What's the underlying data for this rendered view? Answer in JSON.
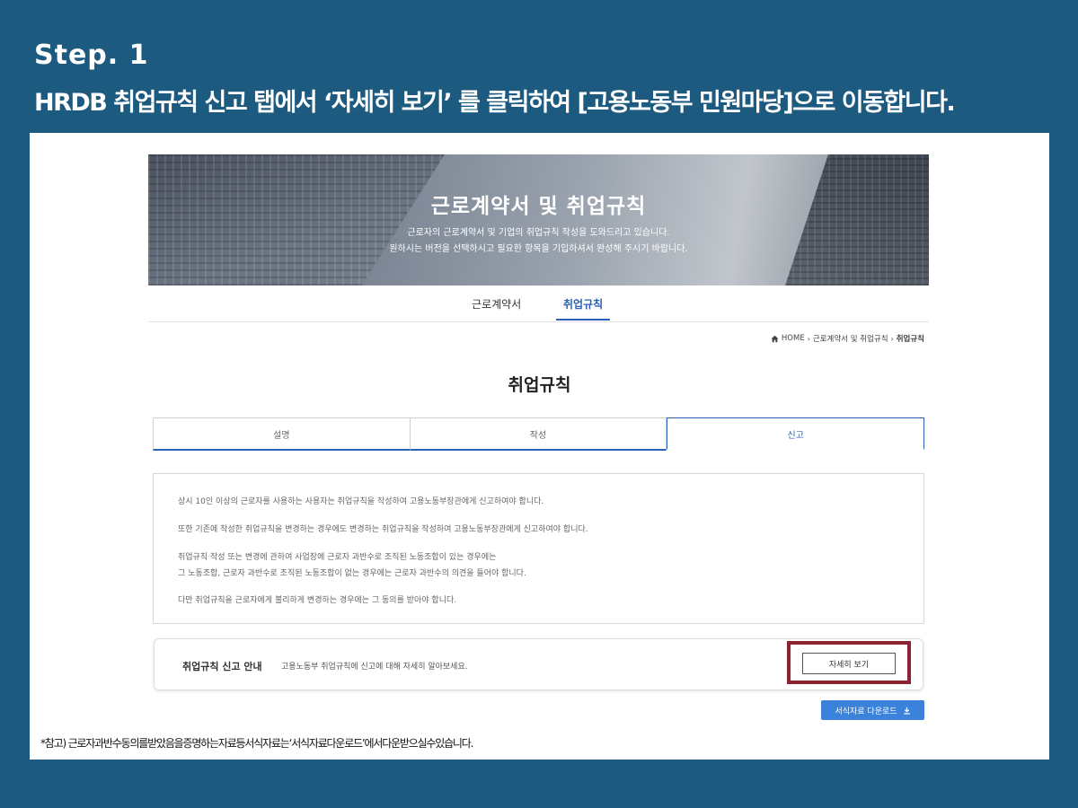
{
  "step": {
    "label": "Step. 1"
  },
  "instruction": "HRDB 취업규칙 신고 탭에서 ‘자세히 보기’ 를 클릭하여 [고용노동부 민원마당]으로 이동합니다.",
  "banner": {
    "title": "근로계약서 및 취업규칙",
    "desc_line1": "근로자의 근로계약서 및 기업의 취업규칙 작성을 도와드리고 있습니다.",
    "desc_line2": "원하시는 버전을 선택하시고 필요한 항목을 기입하셔서 완성해 주시기 바랍니다."
  },
  "subnav": {
    "tab1": "근로계약서",
    "tab2": "취업규칙",
    "active": "취업규칙"
  },
  "breadcrumb": {
    "home": "HOME",
    "level1": "근로계약서 및 취업규칙",
    "current": "취업규칙"
  },
  "page_title": "취업규칙",
  "tabs": [
    {
      "label": "설명"
    },
    {
      "label": "작성"
    },
    {
      "label": "신고"
    }
  ],
  "info": {
    "line1": "상시 10인 이상의 근로자를 사용하는 사용자는 취업규칙을 작성하여 고용노동부장관에게 신고하여야 합니다.",
    "line2": "또한 기존에 작성한 취업규칙을 변경하는 경우에도 변경하는 취업규칙을 작성하여 고용노동부장관에게 신고하여야 합니다.",
    "line3": "취업규칙 작성 또는 변경에 관하여 사업장에 근로자 과반수로 조직된 노동조합이 있는 경우에는",
    "line4": "그 노동조합, 근로자 과반수로 조직된 노동조합이 없는 경우에는 근로자 과반수의 의견을 들어야 합니다.",
    "line5": "다만 취업규칙을 근로자에게 불리하게 변경하는 경우에는 그 동의를 받아야 합니다."
  },
  "guide": {
    "title": "취업규칙 신고 안내",
    "desc": "고용노동부 취업규칙에 신고에 대해 자세히 알아보세요.",
    "button": "자세히 보기"
  },
  "download": {
    "label": "서식자료 다운로드"
  },
  "footnote": "*참고) 근로자과반수동의를받았음을증명하는자료등서식자료는‘서식자료다운로드’에서다운받으실수있습니다.",
  "colors": {
    "background": "#1d5a80",
    "accent": "#2a62b8",
    "highlight": "#8a2432",
    "download": "#3b82db"
  }
}
